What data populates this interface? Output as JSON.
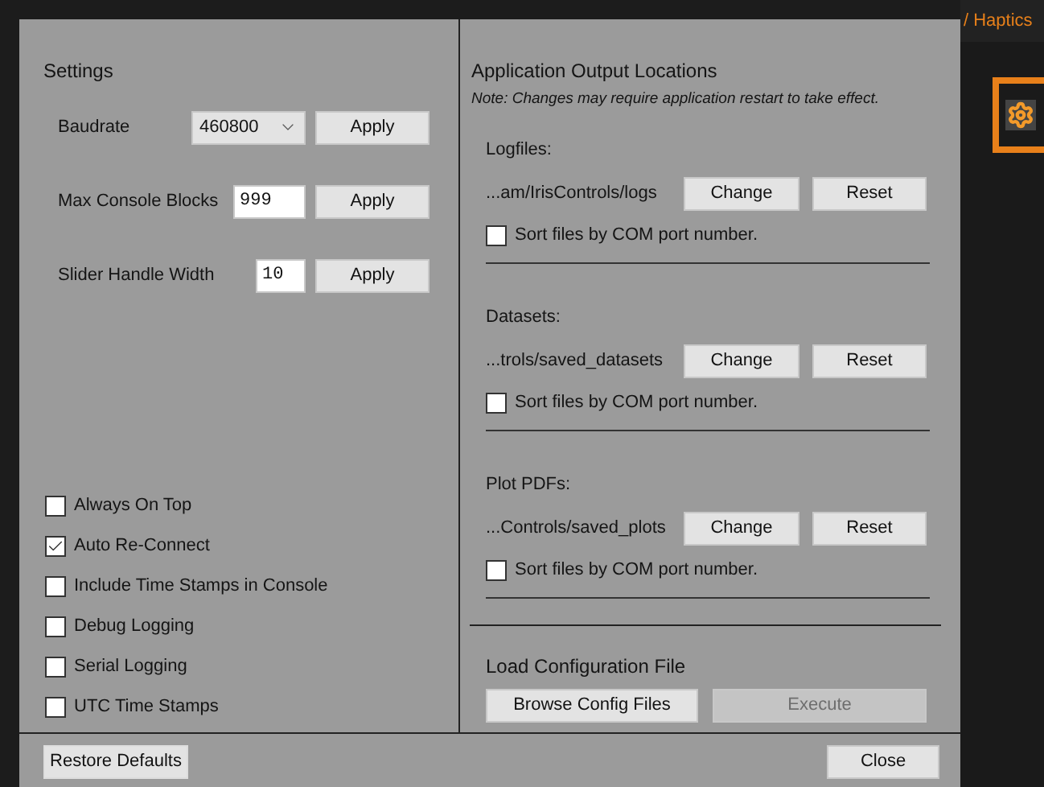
{
  "background": {
    "breadcrumb": "/ Haptics"
  },
  "settings": {
    "title": "Settings",
    "rows": [
      {
        "label": "Baudrate",
        "kind": "select",
        "value": "460800",
        "button": "Apply"
      },
      {
        "label": "Max Console Blocks",
        "kind": "input",
        "value": "999",
        "button": "Apply"
      },
      {
        "label": "Slider Handle Width",
        "kind": "input",
        "value": "10",
        "button": "Apply"
      }
    ],
    "options": [
      {
        "label": "Always On Top",
        "checked": false
      },
      {
        "label": "Auto Re-Connect",
        "checked": true
      },
      {
        "label": "Include Time Stamps in Console",
        "checked": false
      },
      {
        "label": "Debug Logging",
        "checked": false
      },
      {
        "label": "Serial Logging",
        "checked": false
      },
      {
        "label": "UTC Time Stamps",
        "checked": false
      }
    ]
  },
  "output_locations": {
    "title": "Application Output Locations",
    "note": "Note: Changes may require application restart to take effect.",
    "locations": [
      {
        "label": "Logfiles:",
        "path": "...am/IrisControls/logs",
        "change": "Change",
        "reset": "Reset",
        "sort_label": "Sort files by COM port number.",
        "sort_checked": false
      },
      {
        "label": "Datasets:",
        "path": "...trols/saved_datasets",
        "change": "Change",
        "reset": "Reset",
        "sort_label": "Sort files by COM port number.",
        "sort_checked": false
      },
      {
        "label": "Plot PDFs:",
        "path": "...Controls/saved_plots",
        "change": "Change",
        "reset": "Reset",
        "sort_label": "Sort files by COM port number.",
        "sort_checked": false
      }
    ],
    "config": {
      "title": "Load Configuration File",
      "browse": "Browse Config Files",
      "execute": {
        "label": "Execute",
        "disabled": true
      }
    }
  },
  "footer": {
    "restore": "Restore Defaults",
    "close": "Close"
  }
}
